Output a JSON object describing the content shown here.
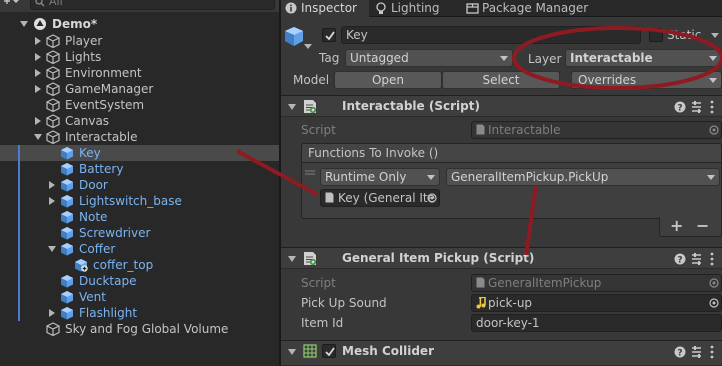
{
  "hierarchy": {
    "search_placeholder": "All",
    "scene_name": "Demo*",
    "items": [
      {
        "label": "Player"
      },
      {
        "label": "Lights"
      },
      {
        "label": "Environment"
      },
      {
        "label": "GameManager"
      },
      {
        "label": "EventSystem"
      },
      {
        "label": "Canvas"
      },
      {
        "label": "Interactable"
      },
      {
        "label": "Key"
      },
      {
        "label": "Battery"
      },
      {
        "label": "Door"
      },
      {
        "label": "Lightswitch_base"
      },
      {
        "label": "Note"
      },
      {
        "label": "Screwdriver"
      },
      {
        "label": "Coffer"
      },
      {
        "label": "coffer_top"
      },
      {
        "label": "Ducktape"
      },
      {
        "label": "Vent"
      },
      {
        "label": "Flashlight"
      },
      {
        "label": "Sky and Fog Global Volume"
      }
    ]
  },
  "tabs": [
    {
      "label": "Inspector",
      "icon": "info-icon"
    },
    {
      "label": "Lighting",
      "icon": "lightbulb-icon"
    },
    {
      "label": "Package Manager",
      "icon": "package-icon"
    }
  ],
  "object": {
    "name": "Key",
    "static_label": "Static",
    "tag_label": "Tag",
    "tag_value": "Untagged",
    "layer_label": "Layer",
    "layer_value": "Interactable",
    "model_label": "Model",
    "open_label": "Open",
    "select_label": "Select",
    "overrides_label": "Overrides"
  },
  "interactable_component": {
    "title": "Interactable (Script)",
    "script_label": "Script",
    "script_value": "Interactable",
    "event_title": "Functions To Invoke ()",
    "runtime_value": "Runtime Only",
    "function_value": "GeneralItemPickup.PickUp",
    "target_value": "Key (General Ite",
    "add_label": "+",
    "remove_label": "−"
  },
  "pickup_component": {
    "title": "General Item Pickup (Script)",
    "script_label": "Script",
    "script_value": "GeneralItemPickup",
    "sound_label": "Pick Up Sound",
    "sound_value": "pick-up",
    "itemid_label": "Item Id",
    "itemid_value": "door-key-1"
  },
  "mesh_component": {
    "title": "Mesh Collider"
  },
  "colors": {
    "annotation": "#8e1b22",
    "prefab_blue": "#7ab4f4",
    "panel": "#383838"
  }
}
